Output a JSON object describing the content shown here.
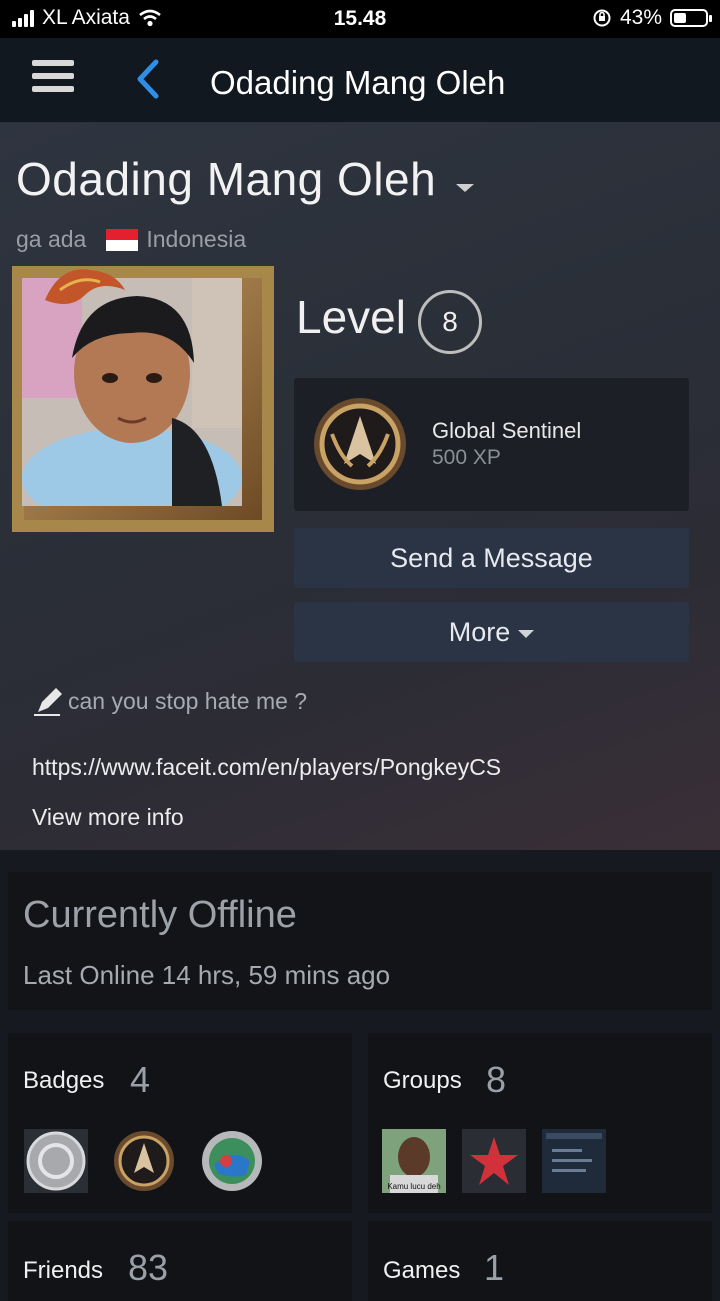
{
  "status_bar": {
    "carrier": "XL Axiata",
    "time": "15.48",
    "battery": "43%"
  },
  "nav": {
    "title": "Odading Mang Oleh"
  },
  "profile": {
    "name": "Odading Mang Oleh",
    "real_name": "ga ada",
    "country": "Indonesia",
    "level_label": "Level",
    "level": "8",
    "badge_title": "Global Sentinel",
    "badge_xp": "500 XP",
    "send_message": "Send a Message",
    "more": "More",
    "summary": "can you stop hate me ?",
    "link": "https://www.faceit.com/en/players/PongkeyCS",
    "view_more": "View more info"
  },
  "status": {
    "state": "Currently Offline",
    "last_online": "Last Online 14 hrs, 59 mins ago"
  },
  "cards": {
    "badges": {
      "label": "Badges",
      "count": "4"
    },
    "groups": {
      "label": "Groups",
      "count": "8"
    },
    "friends": {
      "label": "Friends",
      "count": "83"
    },
    "games": {
      "label": "Games",
      "count": "1"
    }
  },
  "group_thumb_caption": "Kamu lucu deh",
  "colors": {
    "accent_blue": "#2f8fe6",
    "button_bg": "#2b3445"
  }
}
